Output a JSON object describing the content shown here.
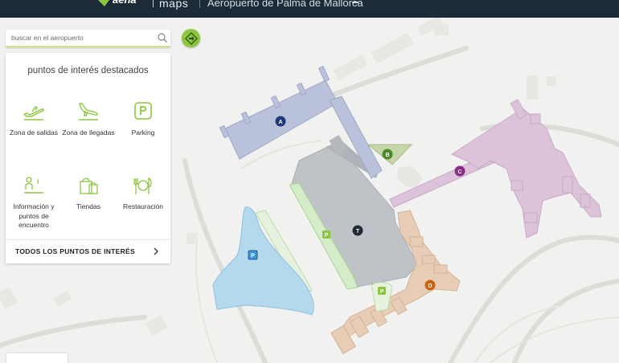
{
  "header": {
    "maps_label": "maps",
    "airport_title": "Aeropuerto de Palma de Mallorca"
  },
  "search": {
    "placeholder": "buscar en el aeropuerto"
  },
  "poi_panel": {
    "title": "puntos de interés destacados",
    "items": [
      {
        "label": "Zona de salidas",
        "icon": "departures-plane-icon"
      },
      {
        "label": "Zona de llegadas",
        "icon": "arrivals-plane-icon"
      },
      {
        "label": "Parking",
        "icon": "parking-icon"
      },
      {
        "label": "Información y puntos de encuentro",
        "icon": "information-point-icon"
      },
      {
        "label": "Tiendas",
        "icon": "shopping-bags-icon"
      },
      {
        "label": "Restauración",
        "icon": "restaurant-icon"
      }
    ],
    "footer_label": "TODOS LOS PUNTOS DE INTERÉS"
  },
  "map_markers": {
    "module_a": "A",
    "module_b": "B",
    "module_c": "C",
    "module_d": "D",
    "terminal": "T",
    "parking_1": "P",
    "parking_2": "P",
    "parking_3": "P"
  },
  "colors": {
    "topbar": "#1d2a38",
    "accent_green": "#8cc63f",
    "module_a": "#b9c2da",
    "module_b": "#c7d6a8",
    "module_c": "#dcc3da",
    "module_d": "#e7cdb5",
    "terminal": "#bfc2c6",
    "parking_area": "#b4d8ec",
    "marker_a": "#1f3b76",
    "marker_b": "#4a8a2a",
    "marker_c": "#8a2b86",
    "marker_d": "#c9630e",
    "marker_t": "#1f2a35",
    "marker_parking_green": "#8cc63f",
    "marker_parking_blue": "#3a9ad9"
  }
}
